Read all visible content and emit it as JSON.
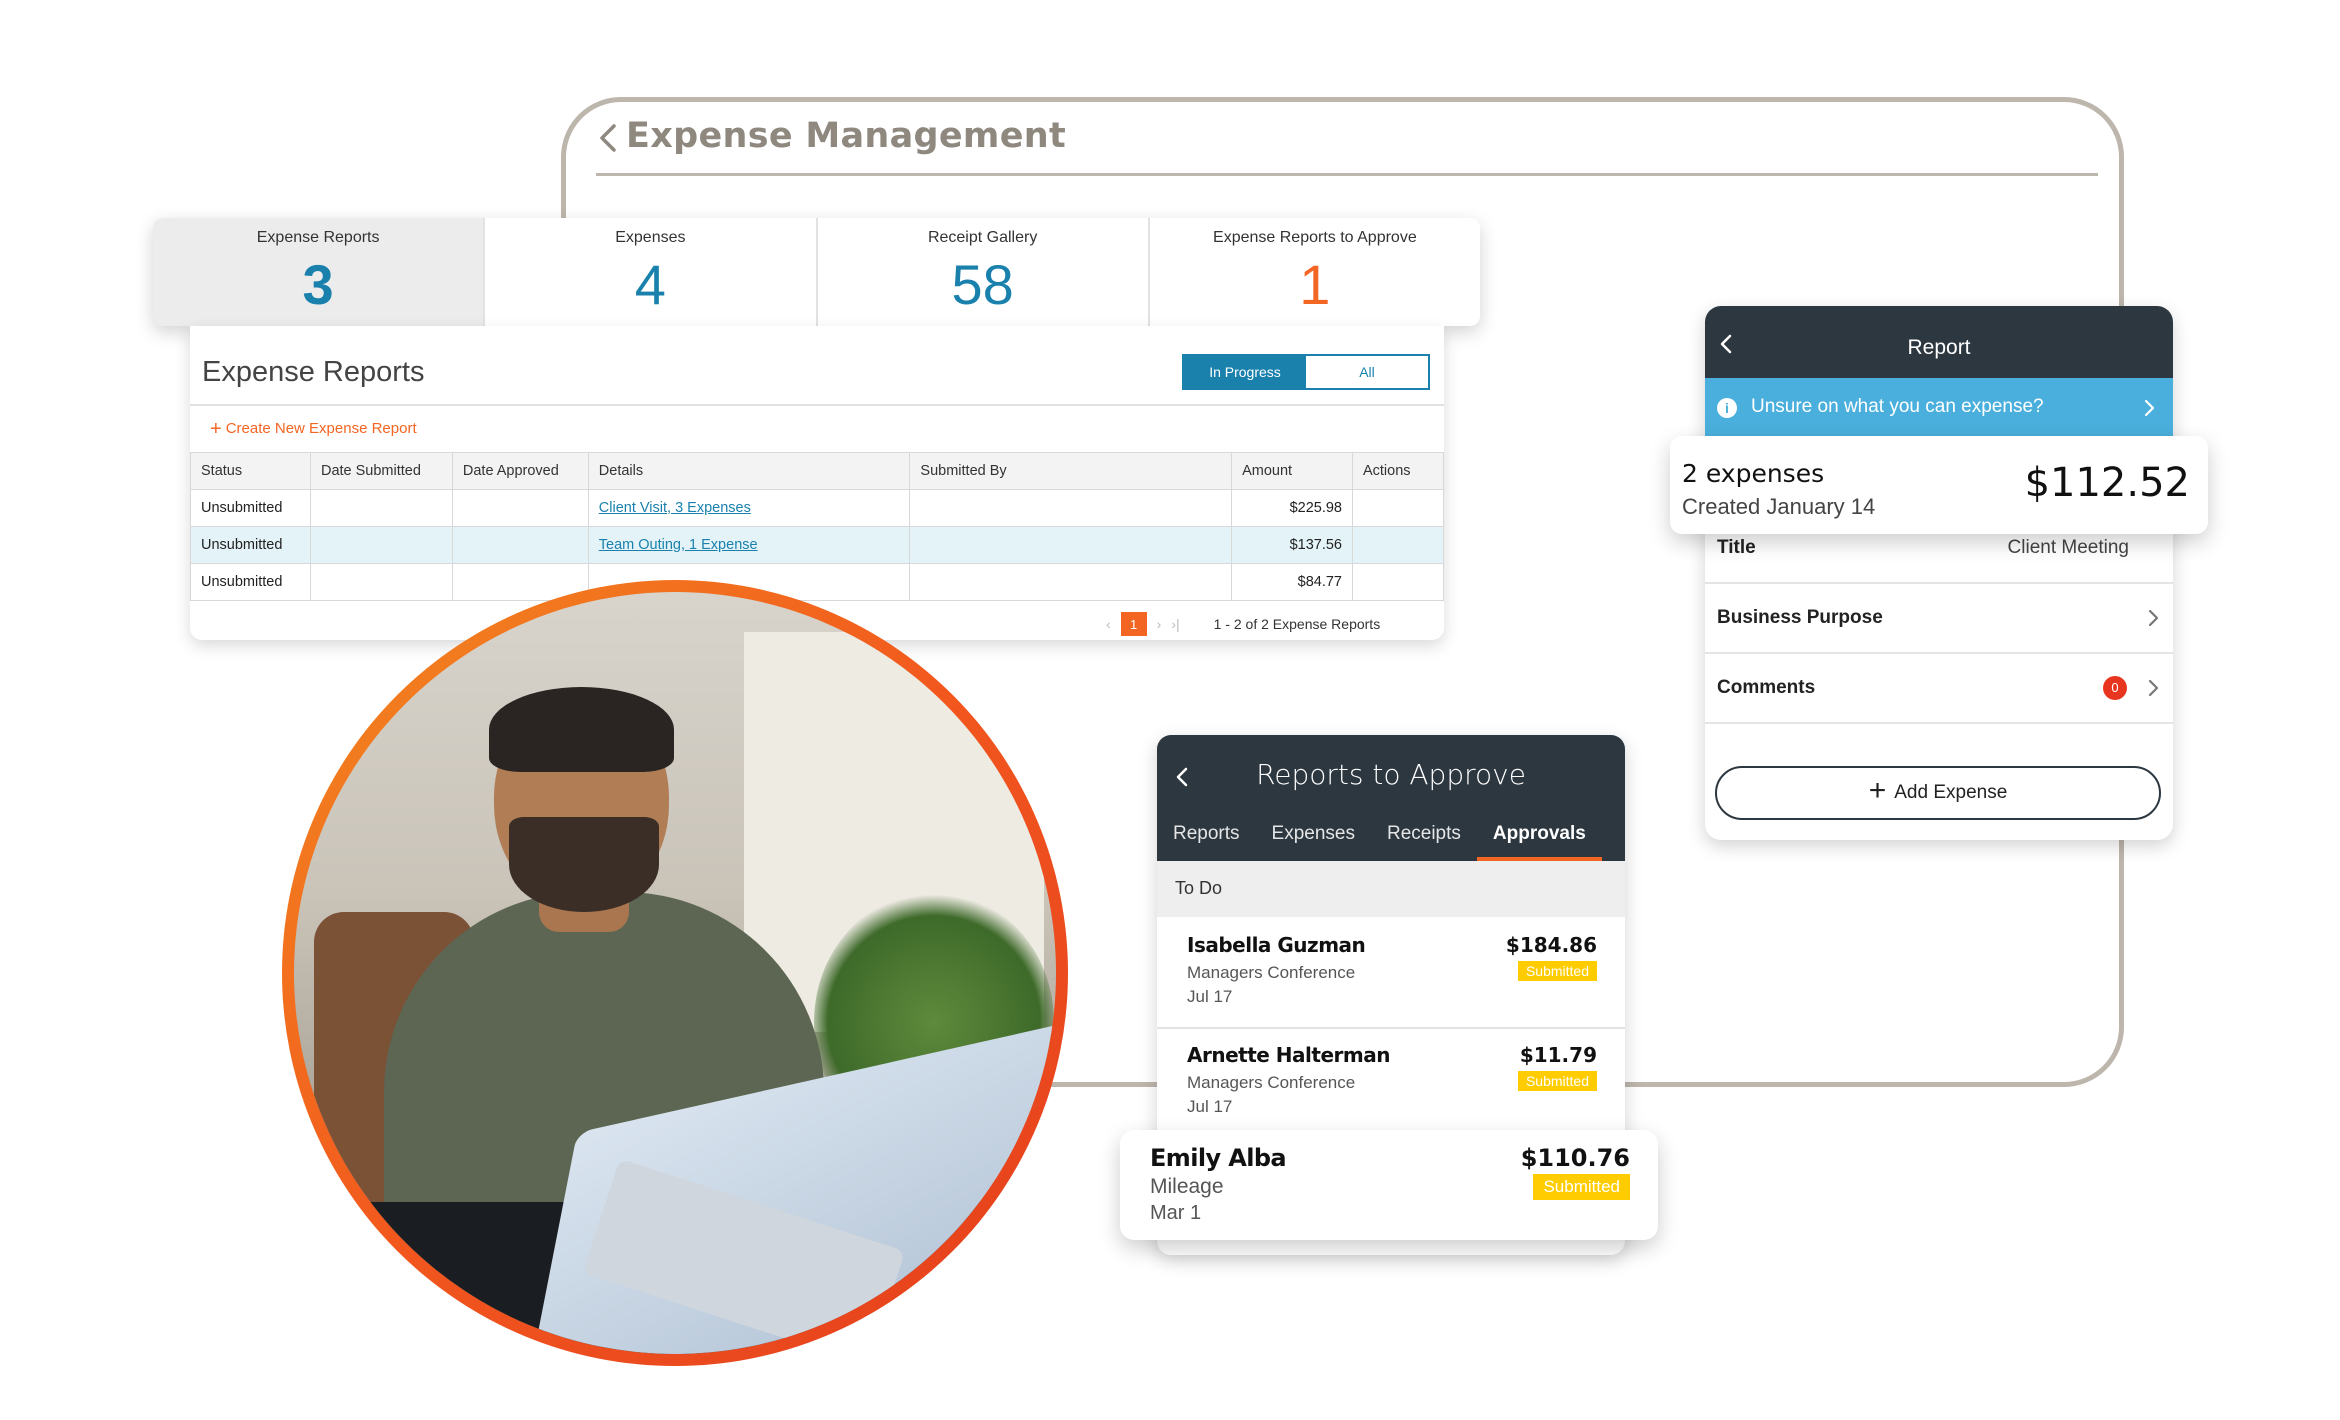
{
  "app": {
    "title": "Expense Management"
  },
  "stats": [
    {
      "label": "Expense Reports",
      "value": "3"
    },
    {
      "label": "Expenses",
      "value": "4"
    },
    {
      "label": "Receipt Gallery",
      "value": "58"
    },
    {
      "label": "Expense Reports to Approve",
      "value": "1"
    }
  ],
  "reports_panel": {
    "title": "Expense Reports",
    "filter_in_progress": "In Progress",
    "filter_all": "All",
    "create_label": "Create New Expense Report",
    "columns": [
      "Status",
      "Date Submitted",
      "Date Approved",
      "Details",
      "Submitted By",
      "Amount",
      "Actions"
    ],
    "rows": [
      {
        "status": "Unsubmitted",
        "details": "Client Visit, 3 Expenses",
        "amount": "$225.98"
      },
      {
        "status": "Unsubmitted",
        "details": "Team Outing, 1 Expense",
        "amount": "$137.56"
      },
      {
        "status": "Unsubmitted",
        "details": "",
        "amount": "$84.77"
      }
    ],
    "pager": {
      "current": "1",
      "info": "1 - 2 of 2 Expense Reports"
    }
  },
  "reports_to_approve": {
    "title": "Reports to Approve",
    "tabs": [
      "Reports",
      "Expenses",
      "Receipts",
      "Approvals"
    ],
    "section": "To Do",
    "items": [
      {
        "name": "Isabella Guzman",
        "subtitle": "Managers Conference",
        "date": "Jul 17",
        "amount": "$184.86",
        "status": "Submitted"
      },
      {
        "name": "Arnette Halterman",
        "subtitle": "Managers Conference",
        "date": "Jul 17",
        "amount": "$11.79",
        "status": "Submitted"
      },
      {
        "name": "Emily Alba",
        "subtitle": "Mileage",
        "date": "Mar 1",
        "amount": "$110.76",
        "status": "Submitted"
      }
    ]
  },
  "report": {
    "title": "Report",
    "info_banner": "Unsure on what you can expense?",
    "summary_count": "2 expenses",
    "summary_created": "Created January 14",
    "summary_amount": "$112.52",
    "title_label": "Title",
    "title_value": "Client Meeting",
    "business_purpose_label": "Business Purpose",
    "comments_label": "Comments",
    "comments_count": "0",
    "add_expense": "Add Expense"
  },
  "colors": {
    "accent_blue": "#1a81ad",
    "accent_orange": "#f26522",
    "dark_header": "#2c3740",
    "badge_yellow": "#ffcc00",
    "info_blue": "#4aafdc"
  }
}
